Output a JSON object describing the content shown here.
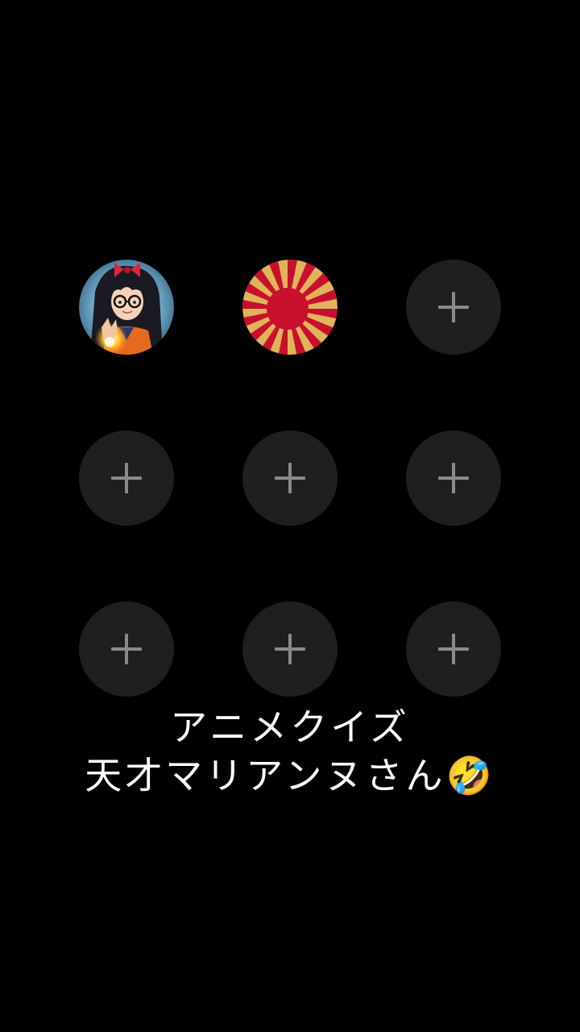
{
  "grid": {
    "slots": [
      {
        "state": "filled",
        "icon": "anime-girl-avatar"
      },
      {
        "state": "filled",
        "icon": "rising-sun-flag-avatar"
      },
      {
        "state": "empty",
        "icon": "plus-icon"
      },
      {
        "state": "empty",
        "icon": "plus-icon"
      },
      {
        "state": "empty",
        "icon": "plus-icon"
      },
      {
        "state": "empty",
        "icon": "plus-icon"
      },
      {
        "state": "empty",
        "icon": "plus-icon"
      },
      {
        "state": "empty",
        "icon": "plus-icon"
      },
      {
        "state": "empty",
        "icon": "plus-icon"
      }
    ]
  },
  "caption": {
    "line1": "アニメクイズ",
    "line2": "天才マリアンヌさん🤣"
  },
  "colors": {
    "background": "#000000",
    "slot_fill": "#1f1f1f",
    "plus": "#8a8a8a",
    "flag_red": "#c8102e",
    "flag_gold": "#e0b45a",
    "text": "#ffffff"
  }
}
